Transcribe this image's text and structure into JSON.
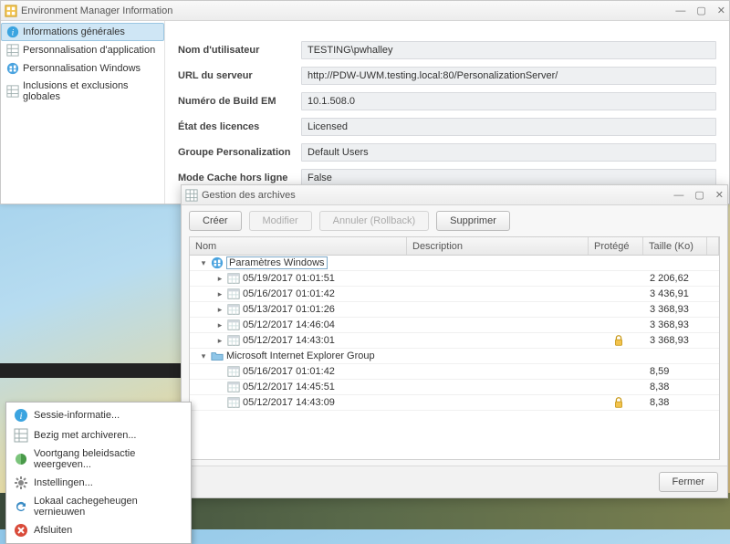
{
  "win1": {
    "title": "Environment Manager Information",
    "nav": [
      {
        "label": "Informations générales",
        "icon": "info-icon",
        "selected": true
      },
      {
        "label": "Personnalisation d'application",
        "icon": "grid-icon"
      },
      {
        "label": "Personnalisation Windows",
        "icon": "windows-icon"
      },
      {
        "label": "Inclusions et exclusions globales",
        "icon": "grid-icon"
      }
    ],
    "fields": [
      {
        "label": "Nom d'utilisateur",
        "value": "TESTING\\pwhalley"
      },
      {
        "label": "URL du serveur",
        "value": "http://PDW-UWM.testing.local:80/PersonalizationServer/"
      },
      {
        "label": "Numéro de Build EM",
        "value": "10.1.508.0"
      },
      {
        "label": "État des licences",
        "value": "Licensed"
      },
      {
        "label": "Groupe Personalization",
        "value": "Default Users"
      },
      {
        "label": "Mode Cache hors ligne",
        "value": "False"
      }
    ]
  },
  "win2": {
    "title": "Gestion des archives",
    "buttons": {
      "create": "Créer",
      "modify": "Modifier",
      "rollback": "Annuler (Rollback)",
      "delete": "Supprimer",
      "close": "Fermer"
    },
    "columns": {
      "name": "Nom",
      "desc": "Description",
      "prot": "Protégé",
      "size": "Taille (Ko)"
    },
    "groups": [
      {
        "label": "Paramètres Windows",
        "icon": "windows-icon",
        "selected": true,
        "rows": [
          {
            "name": "05/19/2017 01:01:51",
            "size": "2 206,62",
            "expandable": true
          },
          {
            "name": "05/16/2017 01:01:42",
            "size": "3 436,91",
            "expandable": true
          },
          {
            "name": "05/13/2017 01:01:26",
            "size": "3 368,93",
            "expandable": true
          },
          {
            "name": "05/12/2017 14:46:04",
            "size": "3 368,93",
            "expandable": true
          },
          {
            "name": "05/12/2017 14:43:01",
            "size": "3 368,93",
            "expandable": true,
            "protected": true
          }
        ]
      },
      {
        "label": "Microsoft Internet Explorer Group",
        "icon": "folder-icon",
        "rows": [
          {
            "name": "05/16/2017 01:01:42",
            "size": "8,59"
          },
          {
            "name": "05/12/2017 14:45:51",
            "size": "8,38"
          },
          {
            "name": "05/12/2017 14:43:09",
            "size": "8,38",
            "protected": true
          }
        ]
      }
    ]
  },
  "menu": [
    {
      "label": "Sessie-informatie...",
      "icon": "info-icon"
    },
    {
      "label": "Bezig met archiveren...",
      "icon": "grid-icon"
    },
    {
      "label": "Voortgang beleidsactie weergeven...",
      "icon": "progress-icon"
    },
    {
      "label": "Instellingen...",
      "icon": "gear-icon"
    },
    {
      "label": "Lokaal cachegeheugen vernieuwen",
      "icon": "refresh-icon"
    },
    {
      "label": "Afsluiten",
      "icon": "close-red-icon"
    }
  ],
  "icons": {
    "minimize": "—",
    "maximize": "▢",
    "close": "✕"
  }
}
